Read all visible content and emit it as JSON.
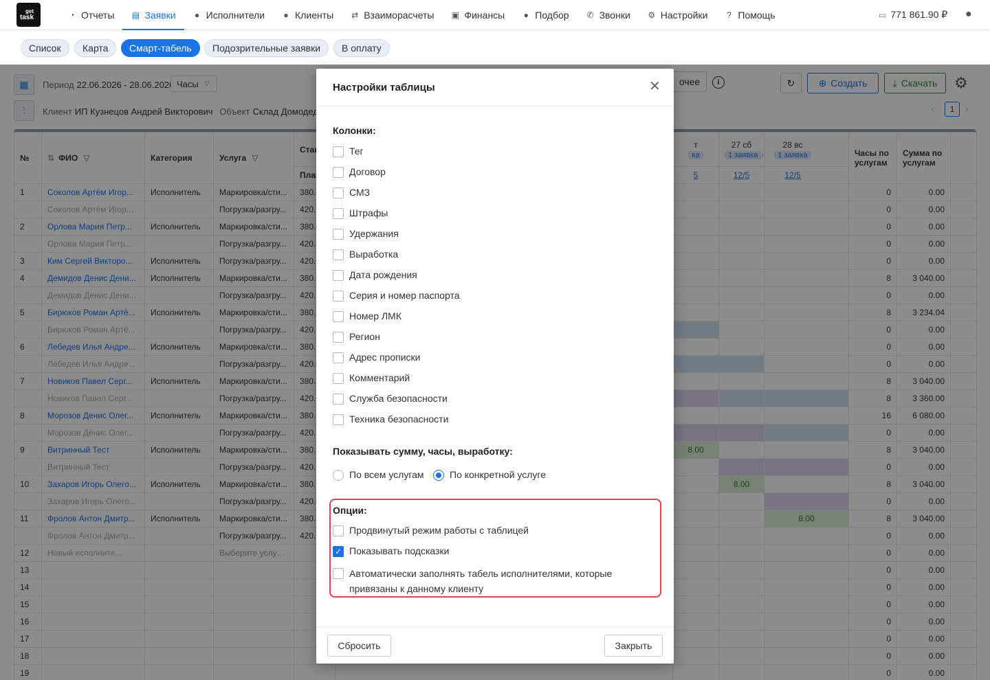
{
  "logo": {
    "line1": "get",
    "line2": "task"
  },
  "nav": {
    "items": [
      {
        "icon": "◔",
        "label": "Отчеты",
        "active": false
      },
      {
        "icon": "▤",
        "label": "Заявки",
        "active": true
      },
      {
        "icon": "●",
        "label": "Исполнители",
        "active": false
      },
      {
        "icon": "●",
        "label": "Клиенты",
        "active": false
      },
      {
        "icon": "⇄",
        "label": "Взаиморасчеты",
        "active": false
      },
      {
        "icon": "▣",
        "label": "Финансы",
        "active": false
      },
      {
        "icon": "●",
        "label": "Подбор",
        "active": false
      },
      {
        "icon": "✆",
        "label": "Звонки",
        "active": false
      },
      {
        "icon": "⚙",
        "label": "Настройки",
        "active": false
      },
      {
        "icon": "?",
        "label": "Помощь",
        "active": false
      }
    ],
    "balance": "771 861.90 ₽"
  },
  "subtabs": [
    "Список",
    "Карта",
    "Смарт-табель",
    "Подозрительные заявки",
    "В оплату"
  ],
  "toolbar": {
    "period_label": "Период",
    "period_value": "22.06.2026 - 28.06.2026",
    "unit_select": "Часы",
    "client_label": "Клиент",
    "client_value": "ИП Кузнецов Андрей Викторович",
    "object_label": "Объект",
    "object_value": "Склад Домодедово",
    "other_btn": "очее",
    "create_btn": "Создать",
    "download_btn": "Скачать",
    "page": "1"
  },
  "table": {
    "headers": {
      "num": "№",
      "fio": "ФИО",
      "category": "Категория",
      "service": "Услуга",
      "rate": "Став",
      "plan": "План",
      "day_left_top": "т",
      "day_left_badge": "ка",
      "day_left_link": "5",
      "day27": "27 сб",
      "day27_badge": "1 заявка",
      "day27_link": "12/5",
      "day28": "28 вс",
      "day28_badge": "1 заявка",
      "day28_link": "12/5",
      "hours": "Часы по услугам",
      "sum": "Сумма по услугам"
    },
    "rows": [
      {
        "num": "1",
        "fio": "Соколов Артём Игор...",
        "sub": false,
        "cat": "Исполнитель",
        "svc": "Маркировка/сти...",
        "rate": "380.0",
        "hours": "0",
        "sum": "0.00",
        "c1": "",
        "c2": "",
        "c3": ""
      },
      {
        "num": "",
        "fio": "Соколов Артём Игор...",
        "sub": true,
        "cat": "",
        "svc": "Погрузка/разгру...",
        "rate": "420.0",
        "hours": "0",
        "sum": "0.00",
        "c1": "",
        "c2": "",
        "c3": ""
      },
      {
        "num": "2",
        "fio": "Орлова Мария Петр...",
        "sub": false,
        "cat": "Исполнитель",
        "svc": "Маркировка/сти...",
        "rate": "380.0",
        "hours": "0",
        "sum": "0.00",
        "c1": "",
        "c2": "",
        "c3": ""
      },
      {
        "num": "",
        "fio": "Орлова Мария Петр...",
        "sub": true,
        "cat": "",
        "svc": "Погрузка/разгру...",
        "rate": "420.0",
        "hours": "0",
        "sum": "0.00",
        "c1": "",
        "c2": "",
        "c3": ""
      },
      {
        "num": "3",
        "fio": "Ким Сергей Викторо...",
        "sub": false,
        "cat": "Исполнитель",
        "svc": "Погрузка/разгру...",
        "rate": "420.0",
        "hours": "0",
        "sum": "0.00",
        "c1": "",
        "c2": "",
        "c3": ""
      },
      {
        "num": "4",
        "fio": "Демидов Денис Дени...",
        "sub": false,
        "cat": "Исполнитель",
        "svc": "Маркировка/сти...",
        "rate": "380.0",
        "hours": "8",
        "sum": "3 040.00",
        "c1": "",
        "c2": "",
        "c3": ""
      },
      {
        "num": "",
        "fio": "Демидов Денис Дени...",
        "sub": true,
        "cat": "",
        "svc": "Погрузка/разгру...",
        "rate": "420.0",
        "hours": "0",
        "sum": "0.00",
        "c1": "",
        "c2": "",
        "c3": ""
      },
      {
        "num": "5",
        "fio": "Бирюков Роман Артё...",
        "sub": false,
        "cat": "Исполнитель",
        "svc": "Маркировка/сти...",
        "rate": "380.0",
        "hours": "8",
        "sum": "3 234.04",
        "c1": "",
        "c2": "",
        "c3": ""
      },
      {
        "num": "",
        "fio": "Бирюков Роман Артё...",
        "sub": true,
        "cat": "",
        "svc": "Погрузка/разгру...",
        "rate": "420.0",
        "hours": "0",
        "sum": "0.00",
        "c1": "blue",
        "c2": "",
        "c3": ""
      },
      {
        "num": "6",
        "fio": "Лебедев Илья Андре...",
        "sub": false,
        "cat": "Исполнитель",
        "svc": "Маркировка/сти...",
        "rate": "380.0",
        "hours": "0",
        "sum": "0.00",
        "c1": "",
        "c2": "",
        "c3": ""
      },
      {
        "num": "",
        "fio": "Лебедев Илья Андре...",
        "sub": true,
        "cat": "",
        "svc": "Погрузка/разгру...",
        "rate": "420.0",
        "hours": "0",
        "sum": "0.00",
        "c1": "blue",
        "c2": "blue",
        "c3": ""
      },
      {
        "num": "7",
        "fio": "Новиков Павел Серг...",
        "sub": false,
        "cat": "Исполнитель",
        "svc": "Маркировка/сти...",
        "rate": "380.0",
        "hours": "8",
        "sum": "3 040.00",
        "c1": "",
        "c2": "",
        "c3": ""
      },
      {
        "num": "",
        "fio": "Новиков Павел Серг...",
        "sub": true,
        "cat": "",
        "svc": "Погрузка/разгру...",
        "rate": "420.0",
        "hours": "8",
        "sum": "3 360.00",
        "c1": "purple",
        "c2": "blue",
        "c3": "blue"
      },
      {
        "num": "8",
        "fio": "Морозов Денис Олег...",
        "sub": false,
        "cat": "Исполнитель",
        "svc": "Маркировка/сти...",
        "rate": "380.0",
        "hours": "16",
        "sum": "6 080.00",
        "c1": "",
        "c2": "",
        "c3": ""
      },
      {
        "num": "",
        "fio": "Морозов Денис Олег...",
        "sub": true,
        "cat": "",
        "svc": "Погрузка/разгру...",
        "rate": "420.0",
        "hours": "0",
        "sum": "0.00",
        "c1": "purple",
        "c2": "purple",
        "c3": "blue"
      },
      {
        "num": "9",
        "fio": "Витринный Тест",
        "sub": false,
        "cat": "Исполнитель",
        "svc": "Маркировка/сти...",
        "rate": "380.0",
        "hours": "8",
        "sum": "3 040.00",
        "c1": "green",
        "c2": "",
        "c3": ""
      },
      {
        "num": "",
        "fio": "Витринный Тест",
        "sub": true,
        "cat": "",
        "svc": "Погрузка/разгру...",
        "rate": "420.0",
        "hours": "0",
        "sum": "0.00",
        "c1": "",
        "c2": "purple",
        "c3": "purple"
      },
      {
        "num": "10",
        "fio": "Захаров Игорь Олего...",
        "sub": false,
        "cat": "Исполнитель",
        "svc": "Маркировка/сти...",
        "rate": "380.0",
        "hours": "8",
        "sum": "3 040.00",
        "c1": "",
        "c2": "green",
        "c3": ""
      },
      {
        "num": "",
        "fio": "Захаров Игорь Олего...",
        "sub": true,
        "cat": "",
        "svc": "Погрузка/разгру...",
        "rate": "420.0",
        "hours": "0",
        "sum": "0.00",
        "c1": "",
        "c2": "",
        "c3": "purple"
      },
      {
        "num": "11",
        "fio": "Фролов Антон Дмитр...",
        "sub": false,
        "cat": "Исполнитель",
        "svc": "Маркировка/сти...",
        "rate": "380.0",
        "hours": "8",
        "sum": "3 040.00",
        "c1": "",
        "c2": "",
        "c3": "green"
      },
      {
        "num": "",
        "fio": "Фролов Антон Дмитр...",
        "sub": true,
        "cat": "",
        "svc": "Погрузка/разгру...",
        "rate": "420.0",
        "hours": "0",
        "sum": "0.00",
        "c1": "",
        "c2": "",
        "c3": ""
      },
      {
        "num": "12",
        "fio": "Новый исполните...",
        "sub": true,
        "cat": "",
        "svc": "Выберите услугу...",
        "rate": "",
        "hours": "0",
        "sum": "0.00",
        "c1": "",
        "c2": "",
        "c3": ""
      },
      {
        "num": "13",
        "fio": "",
        "sub": false,
        "cat": "",
        "svc": "",
        "rate": "",
        "hours": "0",
        "sum": "0.00",
        "c1": "",
        "c2": "",
        "c3": ""
      },
      {
        "num": "14",
        "fio": "",
        "sub": false,
        "cat": "",
        "svc": "",
        "rate": "",
        "hours": "0",
        "sum": "0.00",
        "c1": "",
        "c2": "",
        "c3": ""
      },
      {
        "num": "15",
        "fio": "",
        "sub": false,
        "cat": "",
        "svc": "",
        "rate": "",
        "hours": "0",
        "sum": "0.00",
        "c1": "",
        "c2": "",
        "c3": ""
      },
      {
        "num": "16",
        "fio": "",
        "sub": false,
        "cat": "",
        "svc": "",
        "rate": "",
        "hours": "0",
        "sum": "0.00",
        "c1": "",
        "c2": "",
        "c3": ""
      },
      {
        "num": "17",
        "fio": "",
        "sub": false,
        "cat": "",
        "svc": "",
        "rate": "",
        "hours": "0",
        "sum": "0.00",
        "c1": "",
        "c2": "",
        "c3": ""
      },
      {
        "num": "18",
        "fio": "",
        "sub": false,
        "cat": "",
        "svc": "",
        "rate": "",
        "hours": "0",
        "sum": "0.00",
        "c1": "",
        "c2": "",
        "c3": ""
      },
      {
        "num": "19",
        "fio": "",
        "sub": false,
        "cat": "",
        "svc": "",
        "rate": "",
        "hours": "0",
        "sum": "0.00",
        "c1": "",
        "c2": "",
        "c3": ""
      }
    ],
    "green_value": "8.00"
  },
  "modal": {
    "title": "Настройки таблицы",
    "columns_title": "Колонки:",
    "columns": [
      {
        "label": "Тег",
        "checked": false
      },
      {
        "label": "Договор",
        "checked": false
      },
      {
        "label": "СМЗ",
        "checked": false
      },
      {
        "label": "Штрафы",
        "checked": false
      },
      {
        "label": "Удержания",
        "checked": false
      },
      {
        "label": "Выработка",
        "checked": false
      },
      {
        "label": "Дата рождения",
        "checked": false
      },
      {
        "label": "Серия и номер паспорта",
        "checked": false
      },
      {
        "label": "Номер ЛМК",
        "checked": false
      },
      {
        "label": "Регион",
        "checked": false
      },
      {
        "label": "Адрес прописки",
        "checked": false
      },
      {
        "label": "Комментарий",
        "checked": false
      },
      {
        "label": "Служба безопасности",
        "checked": false
      },
      {
        "label": "Техника безопасности",
        "checked": false
      }
    ],
    "show_title": "Показывать сумму, часы, выработку:",
    "radio_all": "По всем услугам",
    "radio_specific": "По конкретной услуге",
    "options_title": "Опции:",
    "options": [
      {
        "label": "Продвинутый режим работы с таблицей",
        "checked": false
      },
      {
        "label": "Показывать подсказки",
        "checked": true
      },
      {
        "label": "Автоматически заполнять табель исполнителями, которые привязаны к данному клиенту",
        "checked": false
      }
    ],
    "reset_btn": "Сбросить",
    "close_btn": "Закрыть"
  }
}
